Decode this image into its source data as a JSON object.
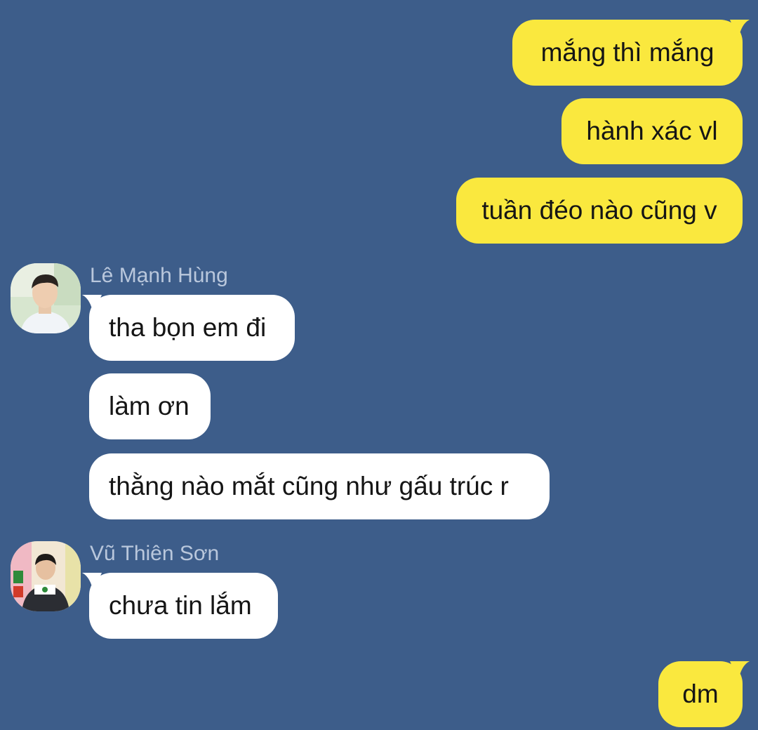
{
  "colors": {
    "background": "#3d5d8a",
    "outgoing_bubble": "#fae83e",
    "incoming_bubble": "#ffffff",
    "sender_name": "#b9c7dc"
  },
  "outgoing_top": [
    {
      "text": "mắng thì mắng"
    },
    {
      "text": "hành xác vl"
    },
    {
      "text": "tuần đéo nào cũng v"
    }
  ],
  "groups": [
    {
      "sender": "Lê Mạnh Hùng",
      "avatar_icon": "avatar-photo",
      "messages": [
        {
          "text": "tha bọn em đi"
        },
        {
          "text": "làm ơn"
        },
        {
          "text": "thằng nào mắt cũng như gấu trúc r"
        }
      ]
    },
    {
      "sender": "Vũ Thiên Sơn",
      "avatar_icon": "avatar-photo",
      "messages": [
        {
          "text": "chưa tin lắm"
        }
      ]
    }
  ],
  "outgoing_bottom": [
    {
      "text": "dm"
    }
  ]
}
